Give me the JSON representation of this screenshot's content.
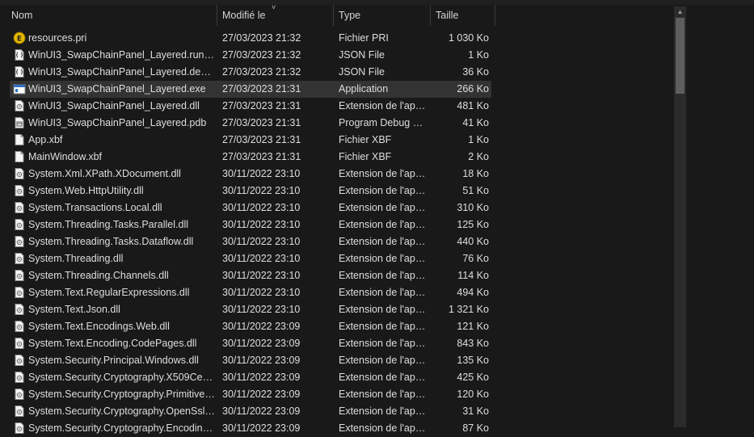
{
  "header": {
    "name": "Nom",
    "modified": "Modifié le",
    "type": "Type",
    "size": "Taille",
    "sort_indicator": "˅"
  },
  "scrollbar": {
    "up_arrow": "▲"
  },
  "files": [
    {
      "name": "resources.pri",
      "date": "27/03/2023 21:32",
      "type": "Fichier PRI",
      "size": "1 030 Ko",
      "icon": "pri-file-icon"
    },
    {
      "name": "WinUI3_SwapChainPanel_Layered.runtim...",
      "date": "27/03/2023 21:32",
      "type": "JSON File",
      "size": "1 Ko",
      "icon": "json-file-icon"
    },
    {
      "name": "WinUI3_SwapChainPanel_Layered.deps.js...",
      "date": "27/03/2023 21:32",
      "type": "JSON File",
      "size": "36 Ko",
      "icon": "json-file-icon"
    },
    {
      "name": "WinUI3_SwapChainPanel_Layered.exe",
      "date": "27/03/2023 21:31",
      "type": "Application",
      "size": "266 Ko",
      "icon": "application-icon"
    },
    {
      "name": "WinUI3_SwapChainPanel_Layered.dll",
      "date": "27/03/2023 21:31",
      "type": "Extension de l'app...",
      "size": "481 Ko",
      "icon": "dll-file-icon"
    },
    {
      "name": "WinUI3_SwapChainPanel_Layered.pdb",
      "date": "27/03/2023 21:31",
      "type": "Program Debug D...",
      "size": "41 Ko",
      "icon": "pdb-file-icon"
    },
    {
      "name": "App.xbf",
      "date": "27/03/2023 21:31",
      "type": "Fichier XBF",
      "size": "1 Ko",
      "icon": "blank-file-icon"
    },
    {
      "name": "MainWindow.xbf",
      "date": "27/03/2023 21:31",
      "type": "Fichier XBF",
      "size": "2 Ko",
      "icon": "blank-file-icon"
    },
    {
      "name": "System.Xml.XPath.XDocument.dll",
      "date": "30/11/2022 23:10",
      "type": "Extension de l'app...",
      "size": "18 Ko",
      "icon": "dll-file-icon"
    },
    {
      "name": "System.Web.HttpUtility.dll",
      "date": "30/11/2022 23:10",
      "type": "Extension de l'app...",
      "size": "51 Ko",
      "icon": "dll-file-icon"
    },
    {
      "name": "System.Transactions.Local.dll",
      "date": "30/11/2022 23:10",
      "type": "Extension de l'app...",
      "size": "310 Ko",
      "icon": "dll-file-icon"
    },
    {
      "name": "System.Threading.Tasks.Parallel.dll",
      "date": "30/11/2022 23:10",
      "type": "Extension de l'app...",
      "size": "125 Ko",
      "icon": "dll-file-icon"
    },
    {
      "name": "System.Threading.Tasks.Dataflow.dll",
      "date": "30/11/2022 23:10",
      "type": "Extension de l'app...",
      "size": "440 Ko",
      "icon": "dll-file-icon"
    },
    {
      "name": "System.Threading.dll",
      "date": "30/11/2022 23:10",
      "type": "Extension de l'app...",
      "size": "76 Ko",
      "icon": "dll-file-icon"
    },
    {
      "name": "System.Threading.Channels.dll",
      "date": "30/11/2022 23:10",
      "type": "Extension de l'app...",
      "size": "114 Ko",
      "icon": "dll-file-icon"
    },
    {
      "name": "System.Text.RegularExpressions.dll",
      "date": "30/11/2022 23:10",
      "type": "Extension de l'app...",
      "size": "494 Ko",
      "icon": "dll-file-icon"
    },
    {
      "name": "System.Text.Json.dll",
      "date": "30/11/2022 23:10",
      "type": "Extension de l'app...",
      "size": "1 321 Ko",
      "icon": "dll-file-icon"
    },
    {
      "name": "System.Text.Encodings.Web.dll",
      "date": "30/11/2022 23:09",
      "type": "Extension de l'app...",
      "size": "121 Ko",
      "icon": "dll-file-icon"
    },
    {
      "name": "System.Text.Encoding.CodePages.dll",
      "date": "30/11/2022 23:09",
      "type": "Extension de l'app...",
      "size": "843 Ko",
      "icon": "dll-file-icon"
    },
    {
      "name": "System.Security.Principal.Windows.dll",
      "date": "30/11/2022 23:09",
      "type": "Extension de l'app...",
      "size": "135 Ko",
      "icon": "dll-file-icon"
    },
    {
      "name": "System.Security.Cryptography.X509Certif...",
      "date": "30/11/2022 23:09",
      "type": "Extension de l'app...",
      "size": "425 Ko",
      "icon": "dll-file-icon"
    },
    {
      "name": "System.Security.Cryptography.Primitives....",
      "date": "30/11/2022 23:09",
      "type": "Extension de l'app...",
      "size": "120 Ko",
      "icon": "dll-file-icon"
    },
    {
      "name": "System.Security.Cryptography.OpenSsl.dll",
      "date": "30/11/2022 23:09",
      "type": "Extension de l'app...",
      "size": "31 Ko",
      "icon": "dll-file-icon"
    },
    {
      "name": "System.Security.Cryptography.Encoding...",
      "date": "30/11/2022 23:09",
      "type": "Extension de l'app...",
      "size": "87 Ko",
      "icon": "dll-file-icon"
    }
  ],
  "selected_index": 3,
  "colors": {
    "background": "#191919",
    "selected_row": "#333333",
    "text": "#dedede"
  }
}
